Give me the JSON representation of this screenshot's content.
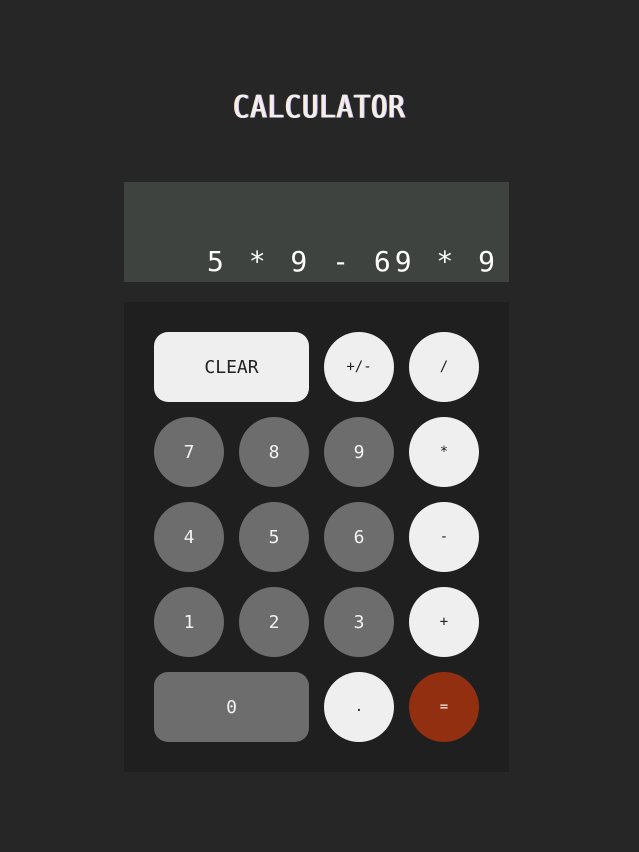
{
  "app": {
    "title": "CALCULATOR"
  },
  "display": {
    "expression": "5 * 9 - 69 * 9"
  },
  "keys": {
    "clear": "CLEAR",
    "sign": "+/-",
    "divide": "/",
    "seven": "7",
    "eight": "8",
    "nine": "9",
    "multiply": "*",
    "four": "4",
    "five": "5",
    "six": "6",
    "subtract": "-",
    "one": "1",
    "two": "2",
    "three": "3",
    "add": "+",
    "zero": "0",
    "decimal": ".",
    "equals": "="
  },
  "colors": {
    "background": "#262626",
    "display_bg": "#3e433f",
    "keypad_bg": "#1f1f1f",
    "light_key": "#efefef",
    "dark_key": "#6d6d6d",
    "equals_key": "#922f10"
  }
}
